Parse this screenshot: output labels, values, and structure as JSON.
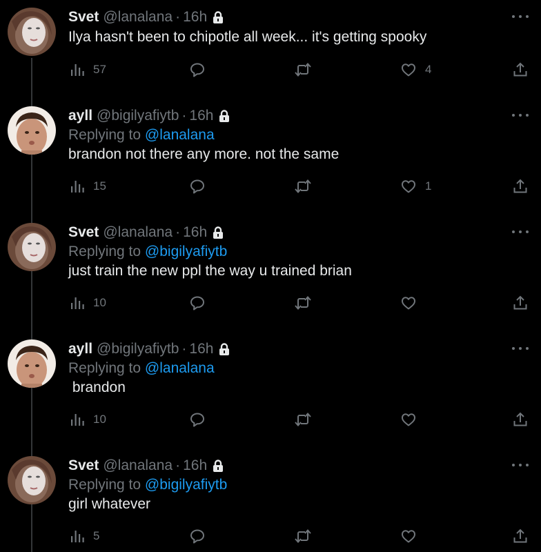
{
  "colors": {
    "background": "#000000",
    "text": "#e7e9ea",
    "muted": "#71767b",
    "link": "#1d9bf0",
    "thread_line": "#333639"
  },
  "icons": {
    "views": "bar-chart-icon",
    "reply": "speech-bubble-icon",
    "retweet": "retweet-arrows-icon",
    "like": "heart-icon",
    "share": "share-upload-icon",
    "protected": "lock-icon",
    "more": "ellipsis-icon"
  },
  "tweets": [
    {
      "display_name": "Svet",
      "handle": "@lanalana",
      "dot": "·",
      "time": "16h",
      "replying_prefix": "",
      "replying_to": "",
      "text": "Ilya hasn't been to chipotle all week... it's getting spooky",
      "views": "57",
      "likes": "4"
    },
    {
      "display_name": "ayll",
      "handle": "@bigilyafiytb",
      "dot": "·",
      "time": "16h",
      "replying_prefix": "Replying to ",
      "replying_to": "@lanalana",
      "text": "brandon not there any more. not the same",
      "views": "15",
      "likes": "1"
    },
    {
      "display_name": "Svet",
      "handle": "@lanalana",
      "dot": "·",
      "time": "16h",
      "replying_prefix": "Replying to ",
      "replying_to": "@bigilyafiytb",
      "text": "just train the new ppl the way u trained brian",
      "views": "10",
      "likes": ""
    },
    {
      "display_name": "ayll",
      "handle": "@bigilyafiytb",
      "dot": "·",
      "time": "16h",
      "replying_prefix": "Replying to ",
      "replying_to": "@lanalana",
      "text": " brandon",
      "views": "10",
      "likes": ""
    },
    {
      "display_name": "Svet",
      "handle": "@lanalana",
      "dot": "·",
      "time": "16h",
      "replying_prefix": "Replying to ",
      "replying_to": "@bigilyafiytb",
      "text": "girl whatever",
      "views": "5",
      "likes": ""
    }
  ]
}
